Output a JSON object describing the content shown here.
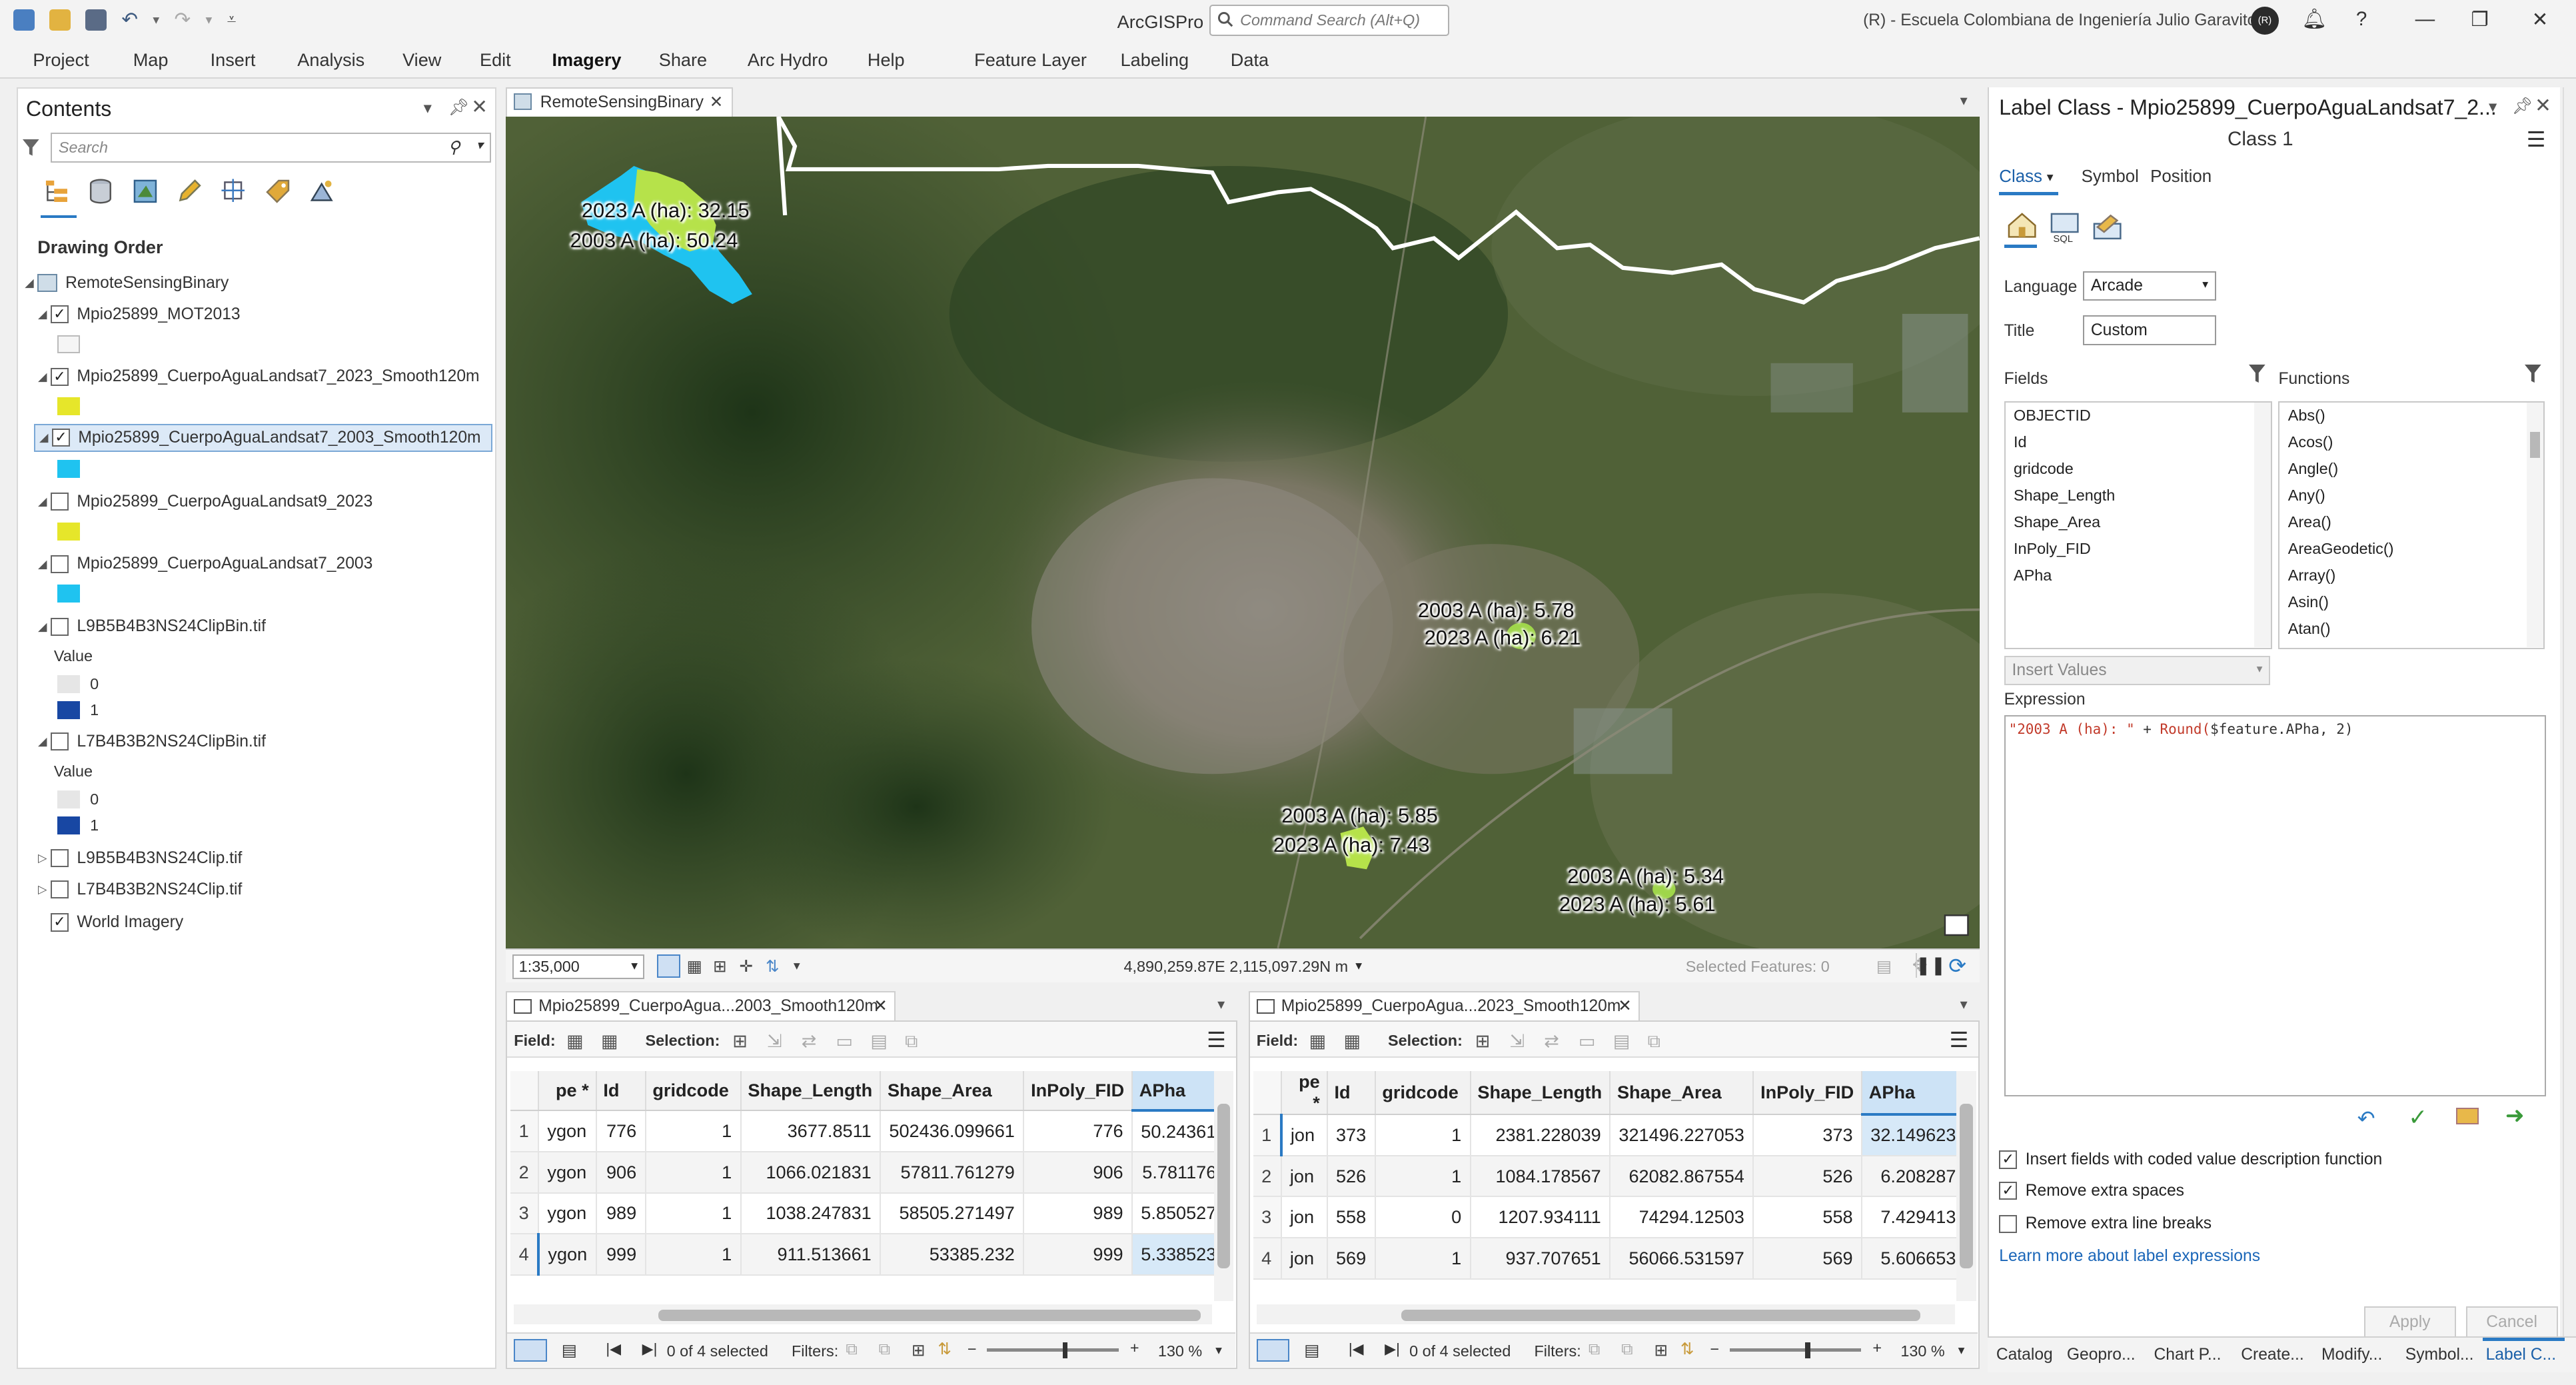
{
  "titlebar": {
    "app_name": "ArcGISPro",
    "search_placeholder": "Command Search (Alt+Q)",
    "org": "(R) - Escuela Colombiana de Ingeniería Julio Garavito",
    "avatar": "(R)"
  },
  "ribbon": {
    "tabs": [
      "Project",
      "Map",
      "Insert",
      "Analysis",
      "View",
      "Edit",
      "Imagery",
      "Share",
      "Arc Hydro",
      "Help",
      "Feature Layer",
      "Labeling",
      "Data"
    ],
    "active": "Imagery"
  },
  "contents": {
    "title": "Contents",
    "search_placeholder": "Search",
    "drawing_order": "Drawing Order",
    "map_name": "RemoteSensingBinary",
    "layers": [
      {
        "name": "Mpio25899_MOT2013",
        "checked": true,
        "swatch": "#f5f5f5"
      },
      {
        "name": "Mpio25899_CuerpoAguaLandsat7_2023_Smooth120m",
        "checked": true,
        "swatch": "#e6e62a"
      },
      {
        "name": "Mpio25899_CuerpoAguaLandsat7_2003_Smooth120m",
        "checked": true,
        "swatch": "#1fc3f0",
        "selected": true
      },
      {
        "name": "Mpio25899_CuerpoAguaLandsat9_2023",
        "checked": false,
        "swatch": "#e6e62a"
      },
      {
        "name": "Mpio25899_CuerpoAguaLandsat7_2003",
        "checked": false,
        "swatch": "#1fc3f0"
      },
      {
        "name": "L9B5B4B3NS24ClipBin.tif",
        "checked": false,
        "value_label": "Value",
        "values": [
          "0",
          "1"
        ]
      },
      {
        "name": "L7B4B3B2NS24ClipBin.tif",
        "checked": false,
        "value_label": "Value",
        "values": [
          "0",
          "1"
        ]
      },
      {
        "name": "L9B5B4B3NS24Clip.tif",
        "checked": false
      },
      {
        "name": "L7B4B3B2NS24Clip.tif",
        "checked": false
      },
      {
        "name": "World Imagery",
        "checked": true
      }
    ]
  },
  "map": {
    "tab_title": "RemoteSensingBinary",
    "labels": [
      {
        "text": "2023 A (ha): 32.15"
      },
      {
        "text": "2003 A (ha): 50.24"
      },
      {
        "text": "2003 A (ha): 5.78"
      },
      {
        "text": "2023 A (ha): 6.21"
      },
      {
        "text": "2003 A (ha): 5.85"
      },
      {
        "text": "2023 A (ha): 7.43"
      },
      {
        "text": "2003 A (ha): 5.34"
      },
      {
        "text": "2023 A (ha): 5.61"
      }
    ],
    "scale": "1:35,000",
    "coords": "4,890,259.87E 2,115,097.29N m",
    "selected_features": "Selected Features: 0"
  },
  "tables": [
    {
      "tab": "Mpio25899_CuerpoAgua...2003_Smooth120m",
      "field_label": "Field:",
      "selection_label": "Selection:",
      "columns": [
        "pe *",
        "Id",
        "gridcode",
        "Shape_Length",
        "Shape_Area",
        "InPoly_FID",
        "APha"
      ],
      "rows": [
        [
          "1",
          "ygon",
          "776",
          "1",
          "3677.8511",
          "502436.099661",
          "776",
          "50.24361"
        ],
        [
          "2",
          "ygon",
          "906",
          "1",
          "1066.021831",
          "57811.761279",
          "906",
          "5.781176"
        ],
        [
          "3",
          "ygon",
          "989",
          "1",
          "1038.247831",
          "58505.271497",
          "989",
          "5.850527"
        ],
        [
          "4",
          "ygon",
          "999",
          "1",
          "911.513661",
          "53385.232",
          "999",
          "5.338523"
        ]
      ],
      "selected_text": "0 of 4 selected",
      "filters_label": "Filters:",
      "zoom": "130 %"
    },
    {
      "tab": "Mpio25899_CuerpoAgua...2023_Smooth120m",
      "field_label": "Field:",
      "selection_label": "Selection:",
      "columns": [
        "pe *",
        "Id",
        "gridcode",
        "Shape_Length",
        "Shape_Area",
        "InPoly_FID",
        "APha"
      ],
      "rows": [
        [
          "1",
          "jon",
          "373",
          "1",
          "2381.228039",
          "321496.227053",
          "373",
          "32.149623"
        ],
        [
          "2",
          "jon",
          "526",
          "1",
          "1084.178567",
          "62082.867554",
          "526",
          "6.208287"
        ],
        [
          "3",
          "jon",
          "558",
          "0",
          "1207.934111",
          "74294.12503",
          "558",
          "7.429413"
        ],
        [
          "4",
          "jon",
          "569",
          "1",
          "937.707651",
          "56066.531597",
          "569",
          "5.606653"
        ]
      ],
      "selected_text": "0 of 4 selected",
      "filters_label": "Filters:",
      "zoom": "130 %"
    }
  ],
  "label_class": {
    "title": "Label Class - Mpio25899_CuerpoAguaLandsat7_2...",
    "class_name": "Class 1",
    "subtabs": [
      "Class",
      "Symbol",
      "Position"
    ],
    "language_label": "Language",
    "language": "Arcade",
    "title_label": "Title",
    "title_value": "Custom",
    "fields_label": "Fields",
    "functions_label": "Functions",
    "fields": [
      "OBJECTID",
      "Id",
      "gridcode",
      "Shape_Length",
      "Shape_Area",
      "InPoly_FID",
      "APha"
    ],
    "functions": [
      "Abs()",
      "Acos()",
      "Angle()",
      "Any()",
      "Area()",
      "AreaGeodetic()",
      "Array()",
      "Asin()",
      "Atan()"
    ],
    "insert_values": "Insert Values",
    "expression_label": "Expression",
    "expression_string": "\"2003 A (ha): \"",
    "expression_plus": " + ",
    "expression_func": "Round(",
    "expression_args": "$feature.APha, 2)",
    "checkbox_coded": "Insert fields with coded value description function",
    "checkbox_spaces": "Remove extra spaces",
    "checkbox_breaks": "Remove extra line breaks",
    "learn_more": "Learn more about label expressions",
    "apply": "Apply",
    "cancel": "Cancel"
  },
  "bottom_tabs": [
    "Catalog",
    "Geopro...",
    "Chart P...",
    "Create...",
    "Modify...",
    "Symbol...",
    "Label C..."
  ]
}
